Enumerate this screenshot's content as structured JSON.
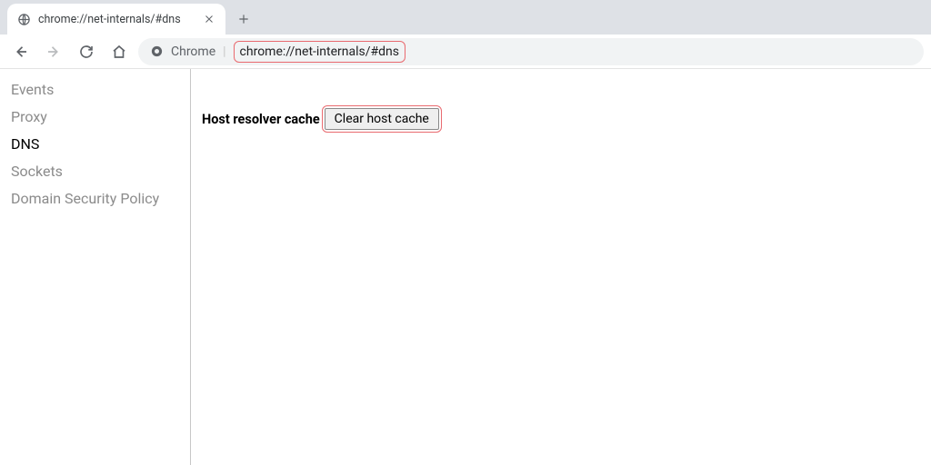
{
  "tab": {
    "title": "chrome://net-internals/#dns"
  },
  "toolbar": {
    "site_label": "Chrome",
    "url": "chrome://net-internals/#dns"
  },
  "sidebar": {
    "items": [
      {
        "label": "Events",
        "active": false
      },
      {
        "label": "Proxy",
        "active": false
      },
      {
        "label": "DNS",
        "active": true
      },
      {
        "label": "Sockets",
        "active": false
      },
      {
        "label": "Domain Security Policy",
        "active": false
      }
    ]
  },
  "main": {
    "label": "Host resolver cache",
    "button": "Clear host cache"
  }
}
